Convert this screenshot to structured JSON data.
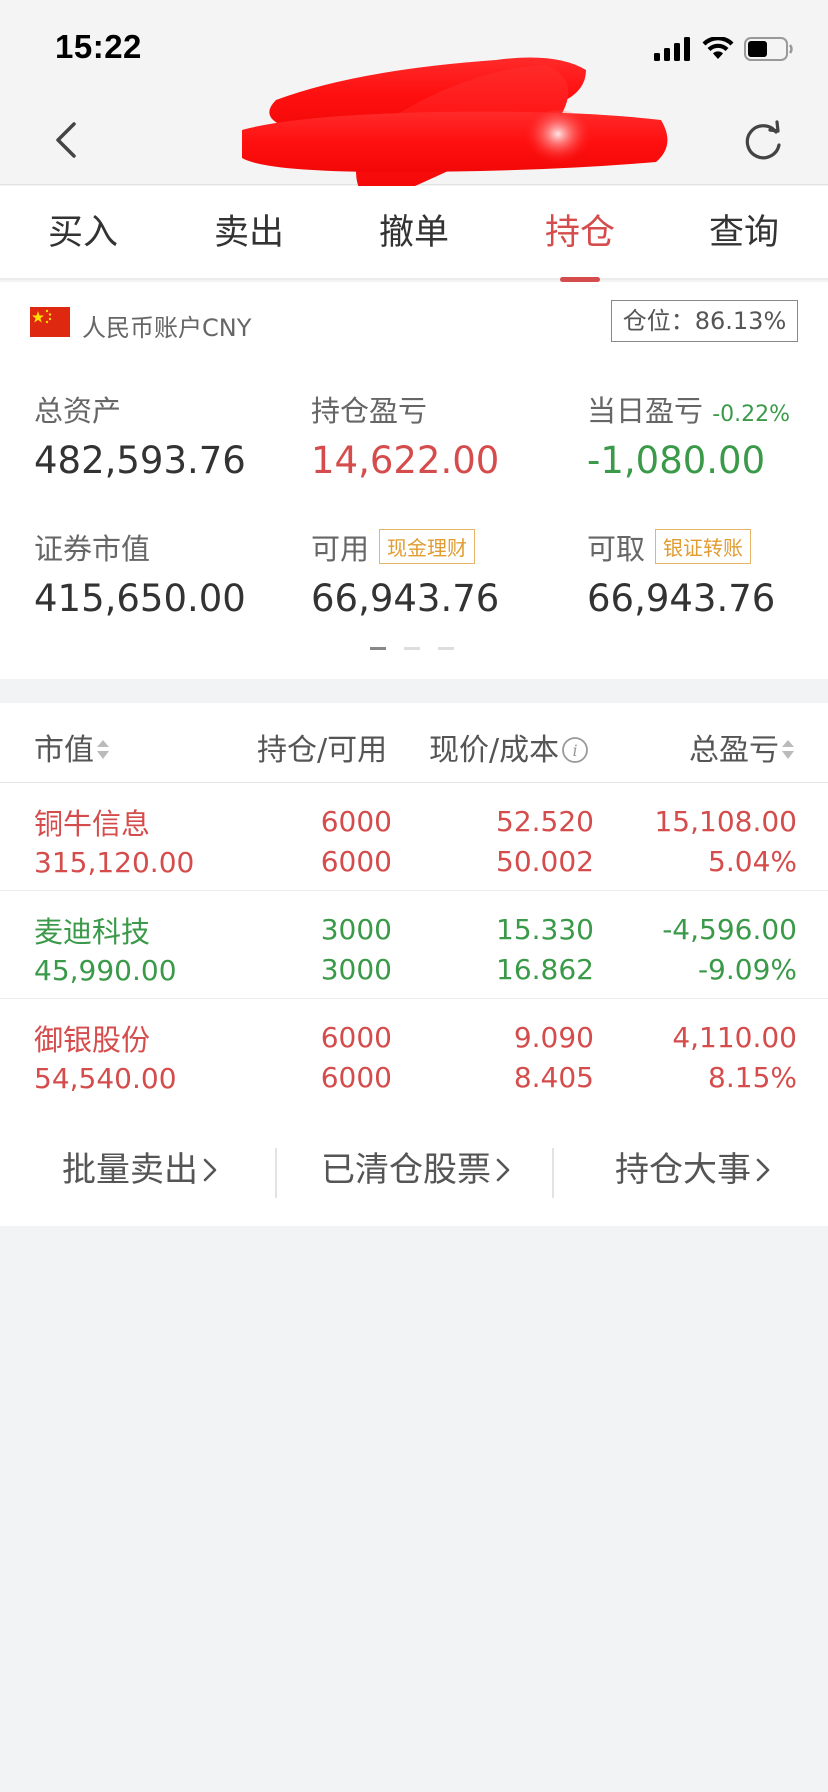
{
  "status_bar": {
    "time": "15:22"
  },
  "tabs": [
    {
      "label": "买入",
      "active": false
    },
    {
      "label": "卖出",
      "active": false
    },
    {
      "label": "撤单",
      "active": false
    },
    {
      "label": "持仓",
      "active": true
    },
    {
      "label": "查询",
      "active": false
    }
  ],
  "account": {
    "name": "人民币账户CNY",
    "position_ratio": "仓位：86.13%"
  },
  "summary": {
    "total_assets_label": "总资产",
    "total_assets": "482,593.76",
    "holding_pl_label": "持仓盈亏",
    "holding_pl": "14,622.00",
    "daily_pl_label": "当日盈亏",
    "daily_pl_pct": "-0.22%",
    "daily_pl": "-1,080.00",
    "market_value_label": "证券市值",
    "market_value": "415,650.00",
    "available_label": "可用",
    "available_tag": "现金理财",
    "available": "66,943.76",
    "withdrawable_label": "可取",
    "withdrawable_tag": "银证转账",
    "withdrawable": "66,943.76"
  },
  "table": {
    "headers": {
      "market_value": "市值",
      "position": "持仓/可用",
      "price_cost": "现价/成本",
      "total_pl": "总盈亏"
    },
    "rows": [
      {
        "name": "铜牛信息",
        "market_value": "315,120.00",
        "position": "6000",
        "available": "6000",
        "price": "52.520",
        "cost": "50.002",
        "pl": "15,108.00",
        "pl_pct": "5.04%",
        "trend": "up"
      },
      {
        "name": "麦迪科技",
        "market_value": "45,990.00",
        "position": "3000",
        "available": "3000",
        "price": "15.330",
        "cost": "16.862",
        "pl": "-4,596.00",
        "pl_pct": "-9.09%",
        "trend": "down"
      },
      {
        "name": "御银股份",
        "market_value": "54,540.00",
        "position": "6000",
        "available": "6000",
        "price": "9.090",
        "cost": "8.405",
        "pl": "4,110.00",
        "pl_pct": "8.15%",
        "trend": "up"
      }
    ]
  },
  "links": {
    "batch_sell": "批量卖出",
    "cleared_stocks": "已清仓股票",
    "holding_events": "持仓大事"
  },
  "colors": {
    "up": "#d54c4c",
    "down": "#3b9a49",
    "accent": "#d54c4c",
    "tag": "#e19c32"
  }
}
